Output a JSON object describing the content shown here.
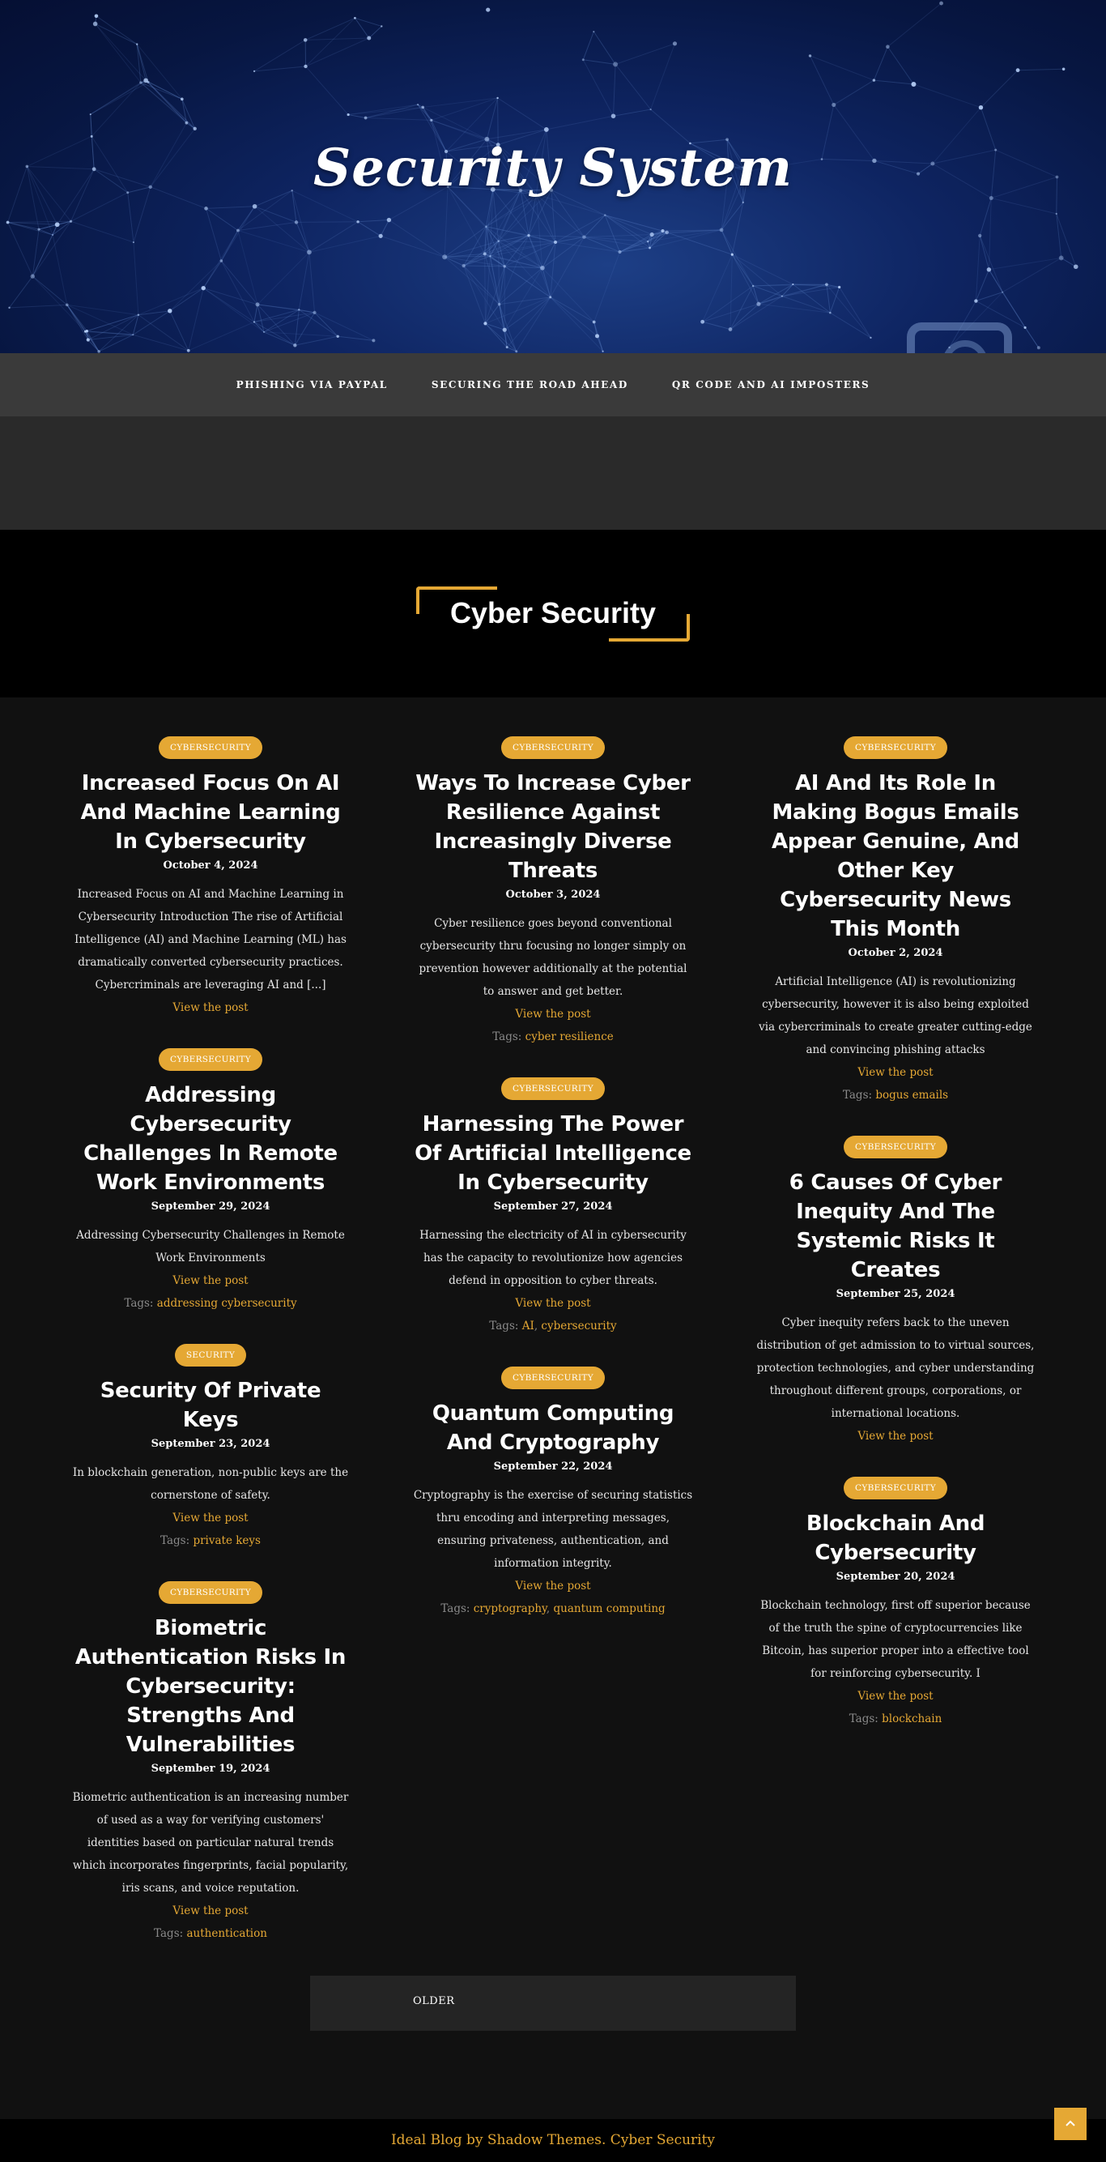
{
  "site": {
    "title": "Security System"
  },
  "nav": {
    "items": [
      {
        "label": "PHISHING VIA PAYPAL"
      },
      {
        "label": "SECURING THE ROAD AHEAD"
      },
      {
        "label": "QR CODE AND AI IMPOSTERS"
      }
    ]
  },
  "section": {
    "heading": "Cyber Security"
  },
  "common": {
    "view_post": "View the post",
    "tags_label": "Tags:"
  },
  "columns": [
    [
      {
        "category": "CYBERSECURITY",
        "title": "Increased Focus On AI And Machine Learning In Cybersecurity",
        "date": "October 4, 2024",
        "excerpt": "Increased Focus on AI and Machine Learning in Cybersecurity Introduction The rise of Artificial Intelligence (AI) and Machine Learning (ML) has dramatically converted cybersecurity practices. Cybercriminals are leveraging AI and [...]",
        "tags": []
      },
      {
        "category": "CYBERSECURITY",
        "title": "Addressing Cybersecurity Challenges In Remote Work Environments",
        "date": "September 29, 2024",
        "excerpt": "Addressing Cybersecurity Challenges in Remote Work Environments",
        "tags": [
          "addressing cybersecurity"
        ]
      },
      {
        "category": "SECURITY",
        "title": "Security Of Private Keys",
        "date": "September 23, 2024",
        "excerpt": "In blockchain generation, non-public keys are the cornerstone of safety.",
        "tags": [
          "private keys"
        ]
      },
      {
        "category": "CYBERSECURITY",
        "title": "Biometric Authentication Risks In Cybersecurity: Strengths And Vulnerabilities",
        "date": "September 19, 2024",
        "excerpt": "Biometric authentication is an increasing number of used as a way for verifying customers' identities based on particular natural trends which incorporates fingerprints, facial popularity, iris scans, and voice reputation.",
        "tags": [
          "authentication"
        ]
      }
    ],
    [
      {
        "category": "CYBERSECURITY",
        "title": "Ways To Increase Cyber Resilience Against Increasingly Diverse Threats",
        "date": "October 3, 2024",
        "excerpt": "Cyber resilience goes beyond conventional cybersecurity thru focusing no longer simply on prevention however additionally at the potential to answer and get better.",
        "tags": [
          "cyber resilience"
        ]
      },
      {
        "category": "CYBERSECURITY",
        "title": "Harnessing The Power Of Artificial Intelligence In Cybersecurity",
        "date": "September 27, 2024",
        "excerpt": "Harnessing the electricity of AI in cybersecurity has the capacity to revolutionize how agencies defend in opposition to cyber threats.",
        "tags": [
          "AI",
          "cybersecurity"
        ]
      },
      {
        "category": "CYBERSECURITY",
        "title": "Quantum Computing And Cryptography",
        "date": "September 22, 2024",
        "excerpt": "Cryptography is the exercise of securing statistics thru encoding and interpreting messages, ensuring privateness, authentication, and information integrity.",
        "tags": [
          "cryptography",
          "quantum computing"
        ]
      }
    ],
    [
      {
        "category": "CYBERSECURITY",
        "title": "AI And Its Role In Making Bogus Emails Appear Genuine, And Other Key Cybersecurity News This Month",
        "date": "October 2, 2024",
        "excerpt": "Artificial Intelligence (AI) is revolutionizing cybersecurity, however it is also being exploited via cybercriminals to create greater cutting-edge and convincing phishing attacks",
        "tags": [
          "bogus emails"
        ]
      },
      {
        "category": "CYBERSECURITY",
        "title": "6 Causes Of Cyber Inequity And The Systemic Risks It Creates",
        "date": "September 25, 2024",
        "excerpt": "Cyber inequity refers back to the uneven distribution of get admission to to virtual sources, protection technologies, and cyber understanding throughout different groups, corporations, or international locations.",
        "tags": []
      },
      {
        "category": "CYBERSECURITY",
        "title": "Blockchain And Cybersecurity",
        "date": "September 20, 2024",
        "excerpt": "Blockchain technology, first off superior because of the truth the spine of cryptocurrencies like Bitcoin, has superior proper into a effective tool for reinforcing cybersecurity. I",
        "tags": [
          "blockchain"
        ]
      }
    ]
  ],
  "pagination": {
    "older_label": "OLDER"
  },
  "footer": {
    "text": "Ideal Blog by Shadow Themes. Cyber Security"
  },
  "colors": {
    "accent": "#e5a834",
    "nav_bg": "#3a3a3a",
    "page_bg": "#111111"
  },
  "icons": {
    "back_to_top": "chevron-up-icon"
  }
}
